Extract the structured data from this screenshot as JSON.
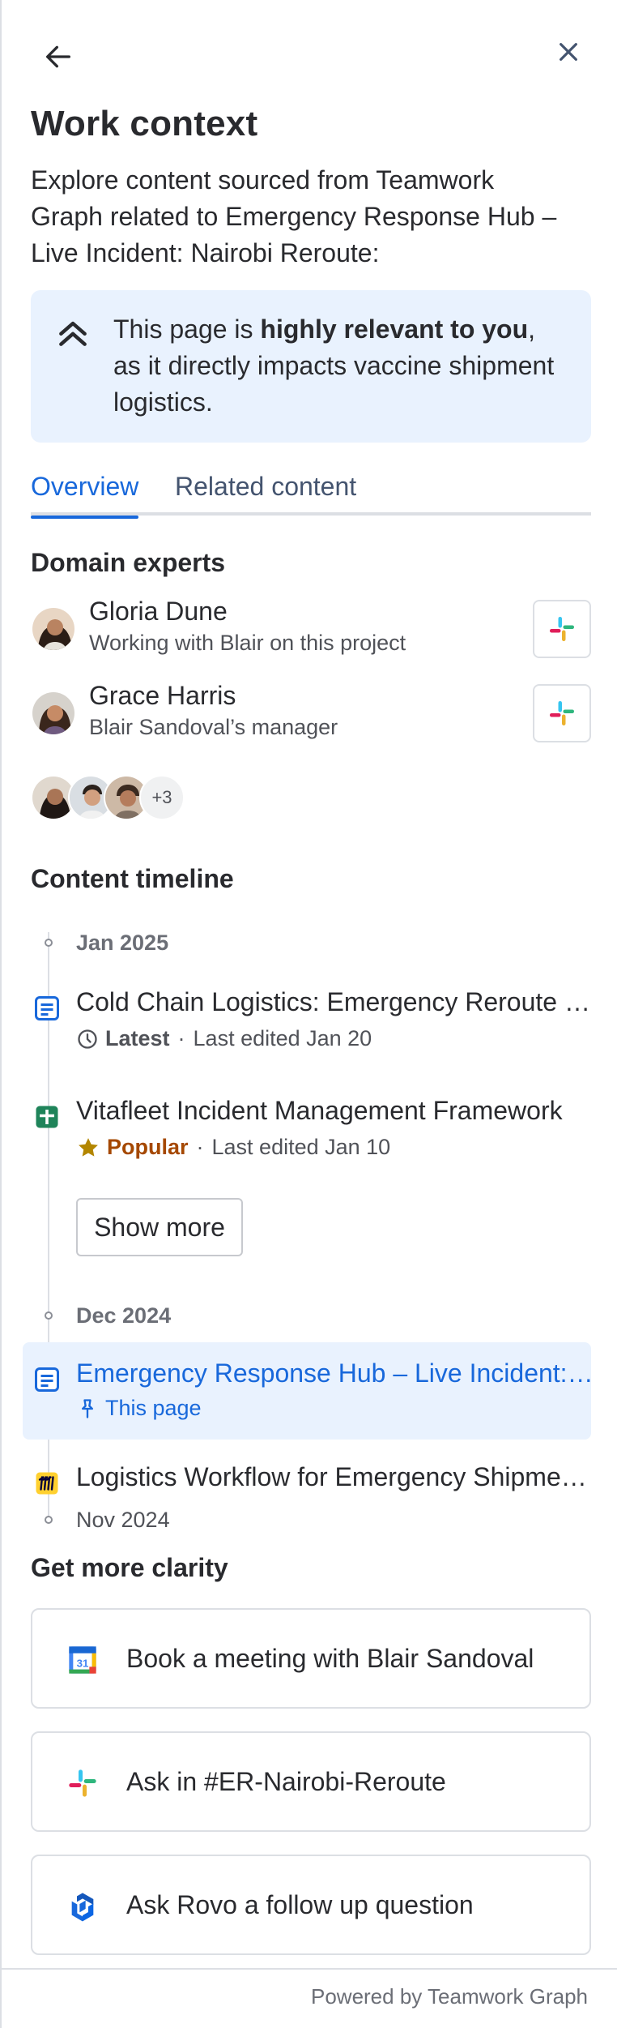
{
  "header": {
    "back_icon": "arrow-left-icon",
    "close_icon": "close-icon",
    "title": "Work context",
    "description": "Explore content sourced from Teamwork Graph related to Emergency Response Hub – Live Incident: Nairobi Reroute:"
  },
  "relevance": {
    "icon": "chevron-double-up-icon",
    "prefix": "This page is ",
    "highlight": "highly relevant to you",
    "suffix": ", as it directly impacts vaccine shipment logistics."
  },
  "tabs": [
    {
      "label": "Overview",
      "active": true
    },
    {
      "label": "Related content",
      "active": false
    }
  ],
  "experts": {
    "heading": "Domain experts",
    "people": [
      {
        "name": "Gloria Dune",
        "role": "Working with Blair on this project",
        "action_icon": "slack-icon"
      },
      {
        "name": "Grace Harris",
        "role": "Blair Sandoval’s manager",
        "action_icon": "slack-icon"
      }
    ],
    "more_count": "+3"
  },
  "timeline": {
    "heading": "Content timeline",
    "groups": [
      {
        "date": "Jan 2025"
      },
      {
        "date": "Dec 2024"
      },
      {
        "date": "Nov 2024"
      }
    ],
    "items": [
      {
        "title": "Cold Chain Logistics: Emergency Reroute Plan",
        "tag": "Latest",
        "tag_icon": "clock-icon",
        "meta": "Last edited Jan 20",
        "icon": "confluence-page-icon"
      },
      {
        "title": "Vitafleet Incident Management Framework",
        "tag": "Popular",
        "tag_icon": "star-icon",
        "meta": "Last edited Jan 10",
        "icon": "spreadsheet-icon"
      },
      {
        "title": "Emergency Response Hub – Live Incident: Nairobi Reroute",
        "tag": "This page",
        "tag_icon": "pin-icon",
        "icon": "confluence-page-icon"
      },
      {
        "title": "Logistics Workflow for Emergency Shipments",
        "icon": "miro-board-icon"
      }
    ],
    "show_more": "Show more"
  },
  "clarity": {
    "heading": "Get more clarity",
    "actions": [
      {
        "label": "Book a meeting with Blair Sandoval",
        "icon": "google-calendar-icon"
      },
      {
        "label": "Ask in #ER-Nairobi-Reroute",
        "icon": "slack-icon"
      },
      {
        "label": "Ask Rovo a follow up question",
        "icon": "rovo-icon"
      }
    ]
  },
  "footer": {
    "text": "Powered by Teamwork Graph"
  },
  "colors": {
    "accent": "#1868DB",
    "highlight_bg": "#E9F2FE",
    "popular": "#A54800",
    "star": "#B38600"
  }
}
